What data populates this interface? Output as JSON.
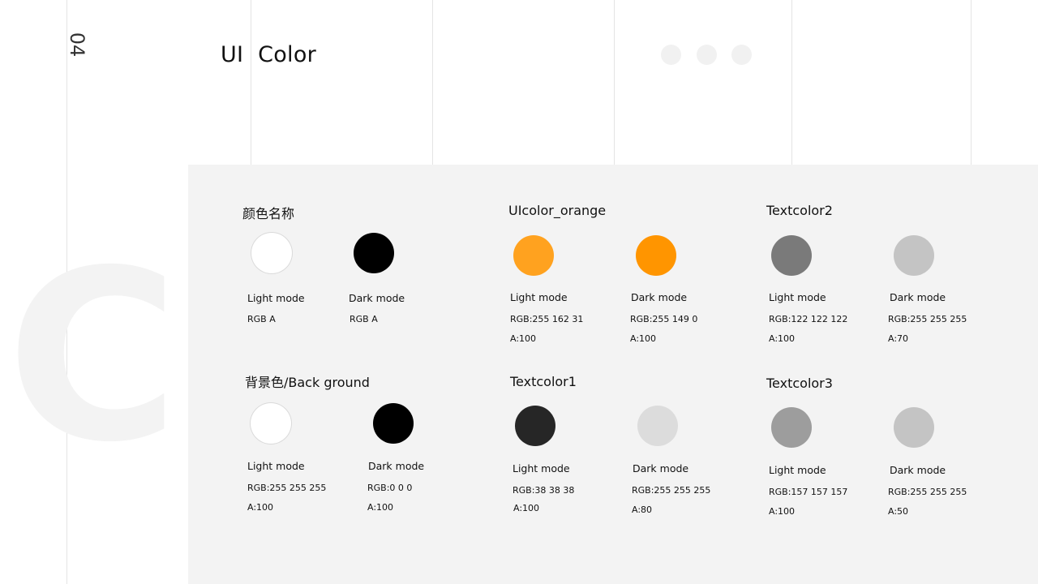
{
  "header": {
    "page_number": "04",
    "title": "UI  Color",
    "watermark_letter": "C",
    "dots": [
      "dot",
      "dot",
      "dot"
    ]
  },
  "colors": {
    "page_bg": "#ffffff",
    "panel_bg": "#f3f3f3"
  },
  "groups": [
    {
      "title": "颜色名称",
      "swatches": [
        {
          "mode": "Light mode",
          "lines": [
            "RGB A"
          ],
          "color": "#ffffff"
        },
        {
          "mode": "Dark mode",
          "lines": [
            "RGB A"
          ],
          "color": "#000000"
        }
      ]
    },
    {
      "title": "UIcolor_orange",
      "swatches": [
        {
          "mode": "Light mode",
          "lines": [
            "RGB:255 162 31",
            "A:100"
          ],
          "color": "#ffa21f"
        },
        {
          "mode": "Dark mode",
          "lines": [
            "RGB:255 149 0",
            "A:100"
          ],
          "color": "#ff9500"
        }
      ]
    },
    {
      "title": "Textcolor2",
      "swatches": [
        {
          "mode": "Light mode",
          "lines": [
            "RGB:122 122 122",
            "A:100"
          ],
          "color": "#7a7a7a"
        },
        {
          "mode": "Dark mode",
          "lines": [
            "RGB:255 255 255",
            "A:70"
          ],
          "color": "#c4c4c4"
        }
      ]
    },
    {
      "title": "背景色/Back ground",
      "swatches": [
        {
          "mode": "Light mode",
          "lines": [
            "RGB:255 255 255",
            "A:100"
          ],
          "color": "#ffffff"
        },
        {
          "mode": "Dark mode",
          "lines": [
            "RGB:0 0 0",
            "A:100"
          ],
          "color": "#000000"
        }
      ]
    },
    {
      "title": "Textcolor1",
      "swatches": [
        {
          "mode": "Light mode",
          "lines": [
            "RGB:38 38 38",
            "A:100"
          ],
          "color": "#262626"
        },
        {
          "mode": "Dark mode",
          "lines": [
            "RGB:255 255 255",
            "A:80"
          ],
          "color": "#dcdcdc"
        }
      ]
    },
    {
      "title": "Textcolor3",
      "swatches": [
        {
          "mode": "Light mode",
          "lines": [
            "RGB:157 157 157",
            "A:100"
          ],
          "color": "#9d9d9d"
        },
        {
          "mode": "Dark mode",
          "lines": [
            "RGB:255 255 255",
            "A:50"
          ],
          "color": "#c4c4c4"
        }
      ]
    }
  ]
}
